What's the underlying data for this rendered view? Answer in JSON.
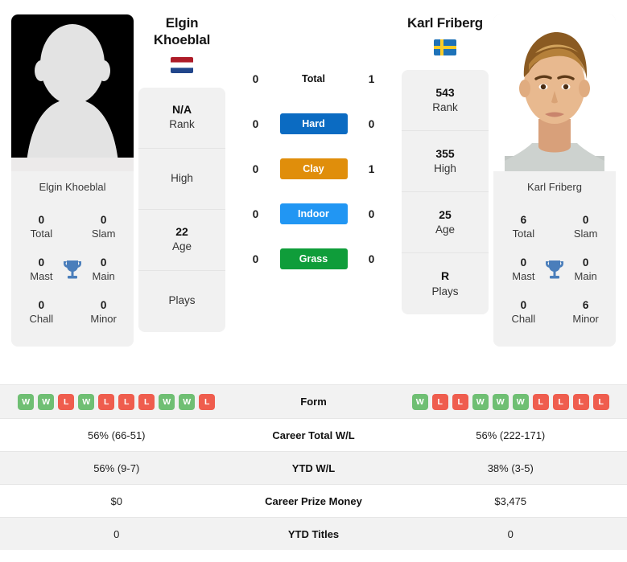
{
  "left_player": {
    "name_line1": "Elgin",
    "name_line2": "Khoeblal",
    "full_name": "Elgin Khoeblal",
    "photo_caption": "Elgin Khoeblal",
    "country": "Netherlands",
    "flag_icon": "netherlands-flag-icon",
    "rank_value": "N/A",
    "rank_label": "Rank",
    "high_value": "",
    "high_label": "High",
    "age_value": "22",
    "age_label": "Age",
    "plays_value": "",
    "plays_label": "Plays",
    "titles": {
      "total_value": "0",
      "total_label": "Total",
      "slam_value": "0",
      "slam_label": "Slam",
      "mast_value": "0",
      "mast_label": "Mast",
      "main_value": "0",
      "main_label": "Main",
      "chall_value": "0",
      "chall_label": "Chall",
      "minor_value": "0",
      "minor_label": "Minor"
    },
    "form": [
      "W",
      "W",
      "L",
      "W",
      "L",
      "L",
      "L",
      "W",
      "W",
      "L"
    ],
    "career_total_wl": "56% (66-51)",
    "ytd_wl": "56% (9-7)",
    "career_prize_money": "$0",
    "ytd_titles": "0"
  },
  "right_player": {
    "name_line1": "Karl Friberg",
    "name_line2": "",
    "full_name": "Karl Friberg",
    "photo_caption": "Karl Friberg",
    "country": "Sweden",
    "flag_icon": "sweden-flag-icon",
    "rank_value": "543",
    "rank_label": "Rank",
    "high_value": "355",
    "high_label": "High",
    "age_value": "25",
    "age_label": "Age",
    "plays_value": "R",
    "plays_label": "Plays",
    "titles": {
      "total_value": "6",
      "total_label": "Total",
      "slam_value": "0",
      "slam_label": "Slam",
      "mast_value": "0",
      "mast_label": "Mast",
      "main_value": "0",
      "main_label": "Main",
      "chall_value": "0",
      "chall_label": "Chall",
      "minor_value": "6",
      "minor_label": "Minor"
    },
    "form": [
      "W",
      "L",
      "L",
      "W",
      "W",
      "W",
      "L",
      "L",
      "L",
      "L"
    ],
    "career_total_wl": "56% (222-171)",
    "ytd_wl": "38% (3-5)",
    "career_prize_money": "$3,475",
    "ytd_titles": "0"
  },
  "head_to_head": [
    {
      "label": "Total",
      "left": "0",
      "right": "1",
      "style": "plain",
      "color": ""
    },
    {
      "label": "Hard",
      "left": "0",
      "right": "0",
      "style": "bar",
      "color": "#0b6bc2"
    },
    {
      "label": "Clay",
      "left": "0",
      "right": "1",
      "style": "bar",
      "color": "#e08e0b"
    },
    {
      "label": "Indoor",
      "left": "0",
      "right": "0",
      "style": "bar",
      "color": "#2196f3"
    },
    {
      "label": "Grass",
      "left": "0",
      "right": "0",
      "style": "bar",
      "color": "#0f9d3a"
    }
  ],
  "stats_rows": [
    {
      "label": "Form",
      "left": "",
      "right": "",
      "type": "form"
    },
    {
      "label": "Career Total W/L",
      "left": "56% (66-51)",
      "right": "56% (222-171)",
      "type": "text"
    },
    {
      "label": "YTD W/L",
      "left": "56% (9-7)",
      "right": "38% (3-5)",
      "type": "text"
    },
    {
      "label": "Career Prize Money",
      "left": "$0",
      "right": "$3,475",
      "type": "text"
    },
    {
      "label": "YTD Titles",
      "left": "0",
      "right": "0",
      "type": "text"
    }
  ],
  "colors": {
    "hard": "#0b6bc2",
    "clay": "#e08e0b",
    "indoor": "#2196f3",
    "grass": "#0f9d3a",
    "win_badge": "#6fbf73",
    "loss_badge": "#ef5d4e",
    "card_bg": "#f1f1f1",
    "row_alt_bg": "#f2f2f2"
  },
  "icons": {
    "trophy": "trophy-icon"
  }
}
